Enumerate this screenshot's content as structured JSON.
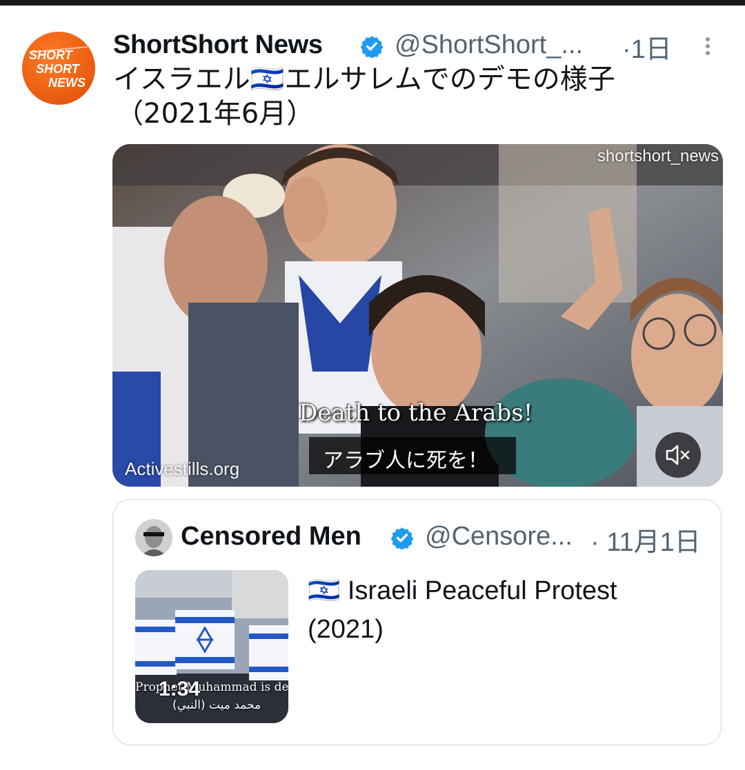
{
  "tweet": {
    "display_name": "ShortShort News",
    "handle": "@ShortShort_...",
    "time": "·1日",
    "text_line1": "イスラエル🇮🇱エルサレムでのデモの様子",
    "text_line2": "（2021年6月）",
    "avatar_logo_text": [
      "SHORT",
      "SHORT",
      "NEWS"
    ],
    "colors": {
      "brand_orange": "#e85a0c",
      "verified_blue": "#1d9bf0",
      "muted_text": "#536471"
    }
  },
  "media": {
    "watermark_top": "shortshort_news",
    "watermark_bottom": "Activestills.org",
    "subtitle_en": "Death to the Arabs!",
    "subtitle_ja": "アラブ人に死を！",
    "mute_icon": "speaker-muted-icon"
  },
  "quote": {
    "display_name": "Censored Men",
    "handle": "@Censore...",
    "time": "· 11月1日",
    "text_line1": "🇮🇱 Israeli Peaceful Protest",
    "text_line2": "(2021)",
    "thumb_duration": "1:34",
    "thumb_caption_en": "Prophet Muhammad is dead",
    "thumb_caption_ar": "(النبي) محمد ميت"
  }
}
